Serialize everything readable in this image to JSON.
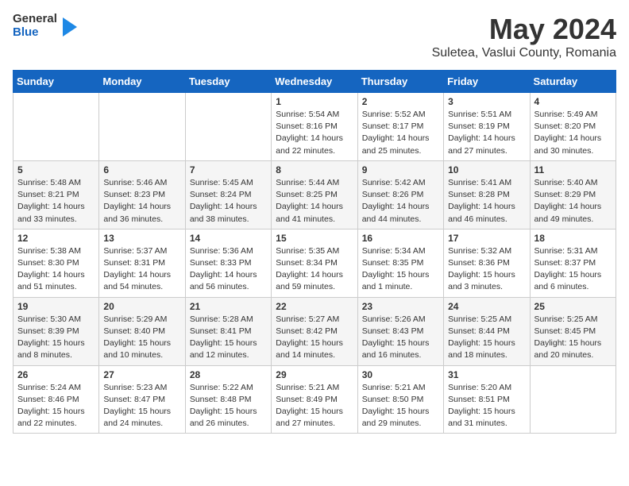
{
  "header": {
    "logo_general": "General",
    "logo_blue": "Blue",
    "title": "May 2024",
    "location": "Suletea, Vaslui County, Romania"
  },
  "days_of_week": [
    "Sunday",
    "Monday",
    "Tuesday",
    "Wednesday",
    "Thursday",
    "Friday",
    "Saturday"
  ],
  "weeks": [
    [
      {
        "day": "",
        "sunrise": "",
        "sunset": "",
        "daylight": ""
      },
      {
        "day": "",
        "sunrise": "",
        "sunset": "",
        "daylight": ""
      },
      {
        "day": "",
        "sunrise": "",
        "sunset": "",
        "daylight": ""
      },
      {
        "day": "1",
        "sunrise": "Sunrise: 5:54 AM",
        "sunset": "Sunset: 8:16 PM",
        "daylight": "Daylight: 14 hours and 22 minutes."
      },
      {
        "day": "2",
        "sunrise": "Sunrise: 5:52 AM",
        "sunset": "Sunset: 8:17 PM",
        "daylight": "Daylight: 14 hours and 25 minutes."
      },
      {
        "day": "3",
        "sunrise": "Sunrise: 5:51 AM",
        "sunset": "Sunset: 8:19 PM",
        "daylight": "Daylight: 14 hours and 27 minutes."
      },
      {
        "day": "4",
        "sunrise": "Sunrise: 5:49 AM",
        "sunset": "Sunset: 8:20 PM",
        "daylight": "Daylight: 14 hours and 30 minutes."
      }
    ],
    [
      {
        "day": "5",
        "sunrise": "Sunrise: 5:48 AM",
        "sunset": "Sunset: 8:21 PM",
        "daylight": "Daylight: 14 hours and 33 minutes."
      },
      {
        "day": "6",
        "sunrise": "Sunrise: 5:46 AM",
        "sunset": "Sunset: 8:23 PM",
        "daylight": "Daylight: 14 hours and 36 minutes."
      },
      {
        "day": "7",
        "sunrise": "Sunrise: 5:45 AM",
        "sunset": "Sunset: 8:24 PM",
        "daylight": "Daylight: 14 hours and 38 minutes."
      },
      {
        "day": "8",
        "sunrise": "Sunrise: 5:44 AM",
        "sunset": "Sunset: 8:25 PM",
        "daylight": "Daylight: 14 hours and 41 minutes."
      },
      {
        "day": "9",
        "sunrise": "Sunrise: 5:42 AM",
        "sunset": "Sunset: 8:26 PM",
        "daylight": "Daylight: 14 hours and 44 minutes."
      },
      {
        "day": "10",
        "sunrise": "Sunrise: 5:41 AM",
        "sunset": "Sunset: 8:28 PM",
        "daylight": "Daylight: 14 hours and 46 minutes."
      },
      {
        "day": "11",
        "sunrise": "Sunrise: 5:40 AM",
        "sunset": "Sunset: 8:29 PM",
        "daylight": "Daylight: 14 hours and 49 minutes."
      }
    ],
    [
      {
        "day": "12",
        "sunrise": "Sunrise: 5:38 AM",
        "sunset": "Sunset: 8:30 PM",
        "daylight": "Daylight: 14 hours and 51 minutes."
      },
      {
        "day": "13",
        "sunrise": "Sunrise: 5:37 AM",
        "sunset": "Sunset: 8:31 PM",
        "daylight": "Daylight: 14 hours and 54 minutes."
      },
      {
        "day": "14",
        "sunrise": "Sunrise: 5:36 AM",
        "sunset": "Sunset: 8:33 PM",
        "daylight": "Daylight: 14 hours and 56 minutes."
      },
      {
        "day": "15",
        "sunrise": "Sunrise: 5:35 AM",
        "sunset": "Sunset: 8:34 PM",
        "daylight": "Daylight: 14 hours and 59 minutes."
      },
      {
        "day": "16",
        "sunrise": "Sunrise: 5:34 AM",
        "sunset": "Sunset: 8:35 PM",
        "daylight": "Daylight: 15 hours and 1 minute."
      },
      {
        "day": "17",
        "sunrise": "Sunrise: 5:32 AM",
        "sunset": "Sunset: 8:36 PM",
        "daylight": "Daylight: 15 hours and 3 minutes."
      },
      {
        "day": "18",
        "sunrise": "Sunrise: 5:31 AM",
        "sunset": "Sunset: 8:37 PM",
        "daylight": "Daylight: 15 hours and 6 minutes."
      }
    ],
    [
      {
        "day": "19",
        "sunrise": "Sunrise: 5:30 AM",
        "sunset": "Sunset: 8:39 PM",
        "daylight": "Daylight: 15 hours and 8 minutes."
      },
      {
        "day": "20",
        "sunrise": "Sunrise: 5:29 AM",
        "sunset": "Sunset: 8:40 PM",
        "daylight": "Daylight: 15 hours and 10 minutes."
      },
      {
        "day": "21",
        "sunrise": "Sunrise: 5:28 AM",
        "sunset": "Sunset: 8:41 PM",
        "daylight": "Daylight: 15 hours and 12 minutes."
      },
      {
        "day": "22",
        "sunrise": "Sunrise: 5:27 AM",
        "sunset": "Sunset: 8:42 PM",
        "daylight": "Daylight: 15 hours and 14 minutes."
      },
      {
        "day": "23",
        "sunrise": "Sunrise: 5:26 AM",
        "sunset": "Sunset: 8:43 PM",
        "daylight": "Daylight: 15 hours and 16 minutes."
      },
      {
        "day": "24",
        "sunrise": "Sunrise: 5:25 AM",
        "sunset": "Sunset: 8:44 PM",
        "daylight": "Daylight: 15 hours and 18 minutes."
      },
      {
        "day": "25",
        "sunrise": "Sunrise: 5:25 AM",
        "sunset": "Sunset: 8:45 PM",
        "daylight": "Daylight: 15 hours and 20 minutes."
      }
    ],
    [
      {
        "day": "26",
        "sunrise": "Sunrise: 5:24 AM",
        "sunset": "Sunset: 8:46 PM",
        "daylight": "Daylight: 15 hours and 22 minutes."
      },
      {
        "day": "27",
        "sunrise": "Sunrise: 5:23 AM",
        "sunset": "Sunset: 8:47 PM",
        "daylight": "Daylight: 15 hours and 24 minutes."
      },
      {
        "day": "28",
        "sunrise": "Sunrise: 5:22 AM",
        "sunset": "Sunset: 8:48 PM",
        "daylight": "Daylight: 15 hours and 26 minutes."
      },
      {
        "day": "29",
        "sunrise": "Sunrise: 5:21 AM",
        "sunset": "Sunset: 8:49 PM",
        "daylight": "Daylight: 15 hours and 27 minutes."
      },
      {
        "day": "30",
        "sunrise": "Sunrise: 5:21 AM",
        "sunset": "Sunset: 8:50 PM",
        "daylight": "Daylight: 15 hours and 29 minutes."
      },
      {
        "day": "31",
        "sunrise": "Sunrise: 5:20 AM",
        "sunset": "Sunset: 8:51 PM",
        "daylight": "Daylight: 15 hours and 31 minutes."
      },
      {
        "day": "",
        "sunrise": "",
        "sunset": "",
        "daylight": ""
      }
    ]
  ]
}
